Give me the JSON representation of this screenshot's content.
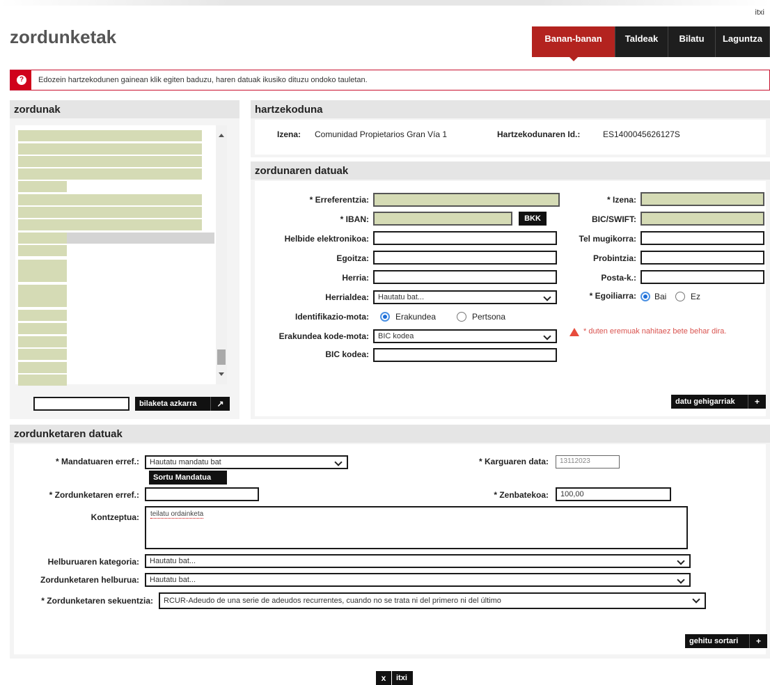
{
  "header": {
    "close_top": "itxi",
    "title": "zordunketak",
    "tabs": [
      "Banan-banan",
      "Taldeak",
      "Bilatu",
      "Laguntza"
    ]
  },
  "alert": {
    "text": "Edozein hartzekodunen gainean klik egiten baduzu, haren datuak ikusiko dituzu ondoko tauletan."
  },
  "zordunak": {
    "title": "zordunak",
    "search_button": "bilaketa azkarra"
  },
  "hartzekoduna": {
    "title": "hartzekoduna",
    "izena_label": "Izena:",
    "izena_value": "Comunidad Propietarios Gran Vía 1",
    "id_label": "Hartzekodunaren Id.:",
    "id_value": "ES1400045626127S"
  },
  "zordunaren": {
    "title": "zordunaren datuak",
    "erreferentzia": "* Erreferentzia:",
    "iban": "* IBAN:",
    "bkk": "BKK",
    "helbide": "Helbide elektronikoa:",
    "egoitza": "Egoitza:",
    "herria": "Herria:",
    "herrialdea": "Herrialdea:",
    "herrialdea_value": "Hautatu bat...",
    "identifikazio": "Identifikazio-mota:",
    "erakundea": "Erakundea",
    "pertsona": "Pertsona",
    "kode_mota": "Erakundea kode-mota:",
    "kode_mota_value": "BIC kodea",
    "bic_kodea": "BIC kodea:",
    "izena": "* Izena:",
    "bic_swift": "BIC/SWIFT:",
    "tel": "Tel mugikorra:",
    "probintzia": "Probintzia:",
    "posta": "Posta-k.:",
    "egoiliarra": "* Egoiliarra:",
    "bai": "Bai",
    "ez": "Ez",
    "required_note": "* duten eremuak nahitaez bete behar dira.",
    "more_button": "datu gehigarriak",
    "more_icon_text": "+"
  },
  "zordunketaren": {
    "title": "zordunketaren datuak",
    "mandatu_label": "* Mandatuaren erref.:",
    "mandatu_value": "Hautatu mandatu bat",
    "sortu_button": "Sortu Mandatua",
    "karguaren_label": "* Karguaren data:",
    "karguaren_value": "13112023",
    "erref_label": "* Zordunketaren erref.:",
    "zenbatekoa_label": "* Zenbatekoa:",
    "zenbatekoa_value": "100,00",
    "kontzeptua_label": "Kontzeptua:",
    "kontzeptua_value": "teilatu ordainketa",
    "kategoria_label": "Helburuaren kategoria:",
    "kategoria_value": "Hautatu bat...",
    "helburua_label": "Zordunketaren helburua:",
    "helburua_value": "Hautatu bat...",
    "sekuentzia_label": "* Zordunketaren sekuentzia:",
    "sekuentzia_value": "RCUR-Adeudo de una serie de adeudos recurrentes, cuando no se trata ni del primero ni del último",
    "gehitu_button": "gehitu sortari",
    "gehitu_icon_text": "+"
  },
  "footer": {
    "close_icon_text": "x",
    "close_label": "itxi"
  }
}
